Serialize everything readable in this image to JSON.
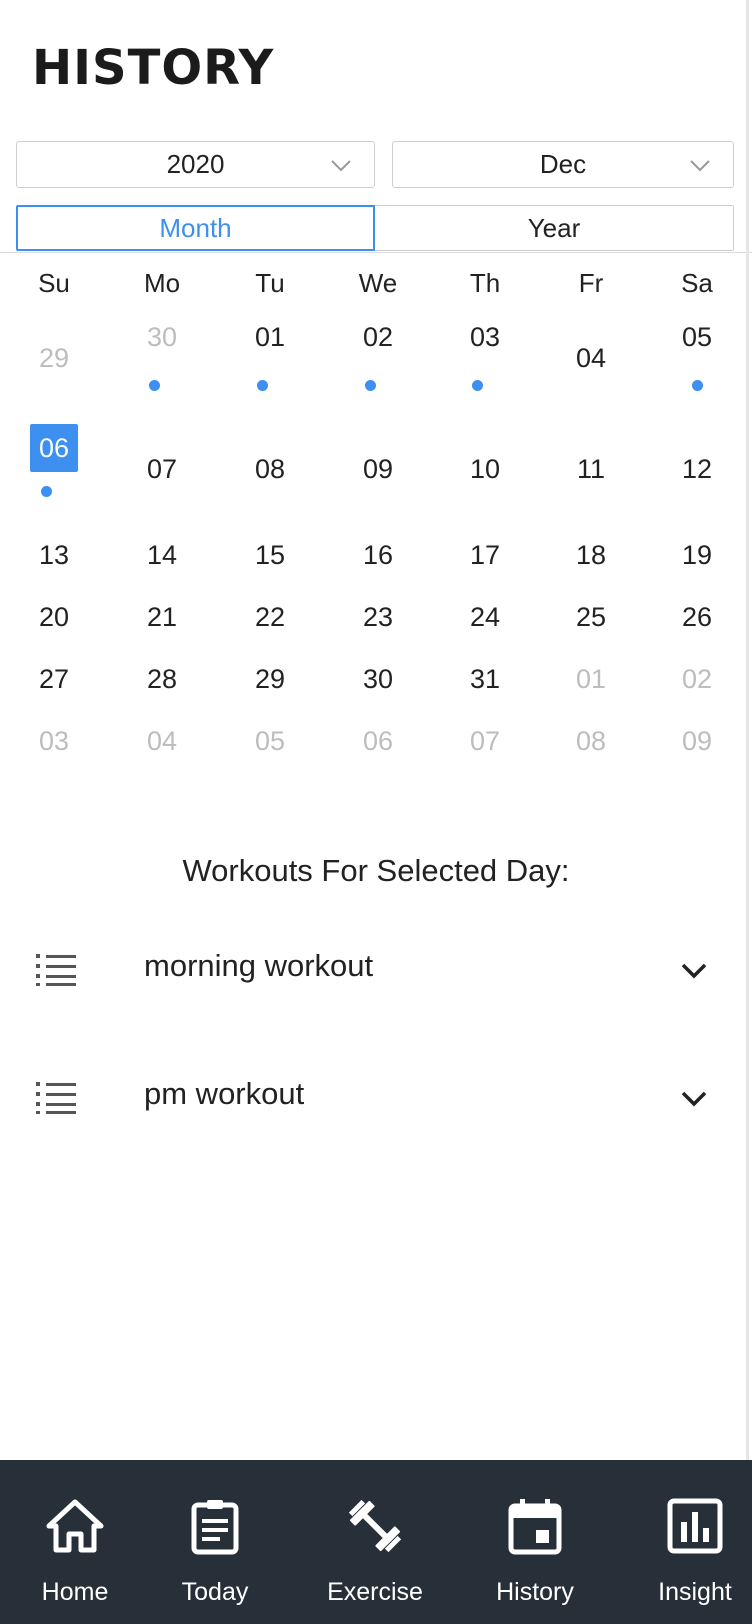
{
  "header": {
    "title": "HISTORY"
  },
  "filters": {
    "year_value": "2020",
    "month_value": "Dec"
  },
  "view_toggle": {
    "month_label": "Month",
    "year_label": "Year",
    "active": "Month"
  },
  "calendar": {
    "weekdays": [
      "Su",
      "Mo",
      "Tu",
      "We",
      "Th",
      "Fr",
      "Sa"
    ],
    "weeks": [
      [
        {
          "d": "29",
          "other": true,
          "dot": false
        },
        {
          "d": "30",
          "other": true,
          "dot": true
        },
        {
          "d": "01",
          "dot": true
        },
        {
          "d": "02",
          "dot": true
        },
        {
          "d": "03",
          "dot": true
        },
        {
          "d": "04",
          "dot": false
        },
        {
          "d": "05",
          "dot": true
        }
      ],
      [
        {
          "d": "06",
          "dot": true,
          "selected": true
        },
        {
          "d": "07"
        },
        {
          "d": "08"
        },
        {
          "d": "09"
        },
        {
          "d": "10"
        },
        {
          "d": "11"
        },
        {
          "d": "12"
        }
      ],
      [
        {
          "d": "13"
        },
        {
          "d": "14"
        },
        {
          "d": "15"
        },
        {
          "d": "16"
        },
        {
          "d": "17"
        },
        {
          "d": "18"
        },
        {
          "d": "19"
        }
      ],
      [
        {
          "d": "20"
        },
        {
          "d": "21"
        },
        {
          "d": "22"
        },
        {
          "d": "23"
        },
        {
          "d": "24"
        },
        {
          "d": "25"
        },
        {
          "d": "26"
        }
      ],
      [
        {
          "d": "27"
        },
        {
          "d": "28"
        },
        {
          "d": "29"
        },
        {
          "d": "30"
        },
        {
          "d": "31"
        },
        {
          "d": "01",
          "other": true
        },
        {
          "d": "02",
          "other": true
        }
      ],
      [
        {
          "d": "03",
          "other": true
        },
        {
          "d": "04",
          "other": true
        },
        {
          "d": "05",
          "other": true
        },
        {
          "d": "06",
          "other": true
        },
        {
          "d": "07",
          "other": true
        },
        {
          "d": "08",
          "other": true
        },
        {
          "d": "09",
          "other": true
        }
      ]
    ]
  },
  "workouts": {
    "title": "Workouts For Selected Day:",
    "items": [
      {
        "label": "morning workout",
        "icon": "list-icon"
      },
      {
        "label": "pm workout",
        "icon": "list-icon"
      }
    ]
  },
  "tabbar": {
    "tabs": [
      {
        "label": "Home",
        "icon": "home-icon"
      },
      {
        "label": "Today",
        "icon": "clipboard-icon"
      },
      {
        "label": "Exercise",
        "icon": "dumbbell-icon"
      },
      {
        "label": "History",
        "icon": "calendar-icon"
      },
      {
        "label": "Insight",
        "icon": "bar-chart-icon"
      }
    ]
  },
  "colors": {
    "accent": "#3d8ff0",
    "tabbar_bg": "#273038",
    "muted_day": "#bdbdbd"
  }
}
